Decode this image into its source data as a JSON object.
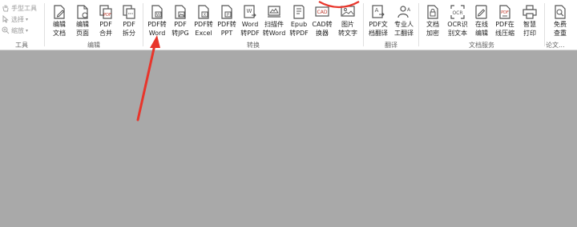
{
  "tools_group": {
    "hand": "手型工具",
    "select": "选择",
    "zoom": "缩放",
    "label": "工具"
  },
  "edit_group": {
    "label": "编辑",
    "buttons": [
      {
        "l1": "编辑",
        "l2": "文档"
      },
      {
        "l1": "编辑",
        "l2": "页面"
      },
      {
        "l1": "PDF",
        "l2": "合并"
      },
      {
        "l1": "PDF",
        "l2": "拆分"
      }
    ]
  },
  "convert_group": {
    "label": "转换",
    "buttons": [
      {
        "l1": "PDF转",
        "l2": "Word"
      },
      {
        "l1": "PDF",
        "l2": "转JPG"
      },
      {
        "l1": "PDF转",
        "l2": "Excel"
      },
      {
        "l1": "PDF转",
        "l2": "PPT"
      },
      {
        "l1": "Word",
        "l2": "转PDF"
      },
      {
        "l1": "扫描件",
        "l2": "转Word"
      },
      {
        "l1": "Epub",
        "l2": "转PDF"
      },
      {
        "l1": "CAD转",
        "l2": "换器"
      },
      {
        "l1": "图片",
        "l2": "转文字"
      }
    ]
  },
  "translate_group": {
    "label": "翻译",
    "buttons": [
      {
        "l1": "PDF文",
        "l2": "档翻译"
      },
      {
        "l1": "专业人",
        "l2": "工翻译"
      }
    ]
  },
  "service_group": {
    "label": "文档服务",
    "buttons": [
      {
        "l1": "文档",
        "l2": "加密"
      },
      {
        "l1": "OCR识",
        "l2": "别文本"
      },
      {
        "l1": "在线",
        "l2": "编辑"
      },
      {
        "l1": "PDF在",
        "l2": "线压缩"
      },
      {
        "l1": "智慧",
        "l2": "打印"
      }
    ]
  },
  "paper_group": {
    "label": "论文...",
    "buttons": [
      {
        "l1": "免费",
        "l2": "查重"
      }
    ]
  },
  "colors": {
    "annotation_red": "#e8352b",
    "icon_stroke": "#555555",
    "canvas_gray": "#a9a9a9"
  }
}
